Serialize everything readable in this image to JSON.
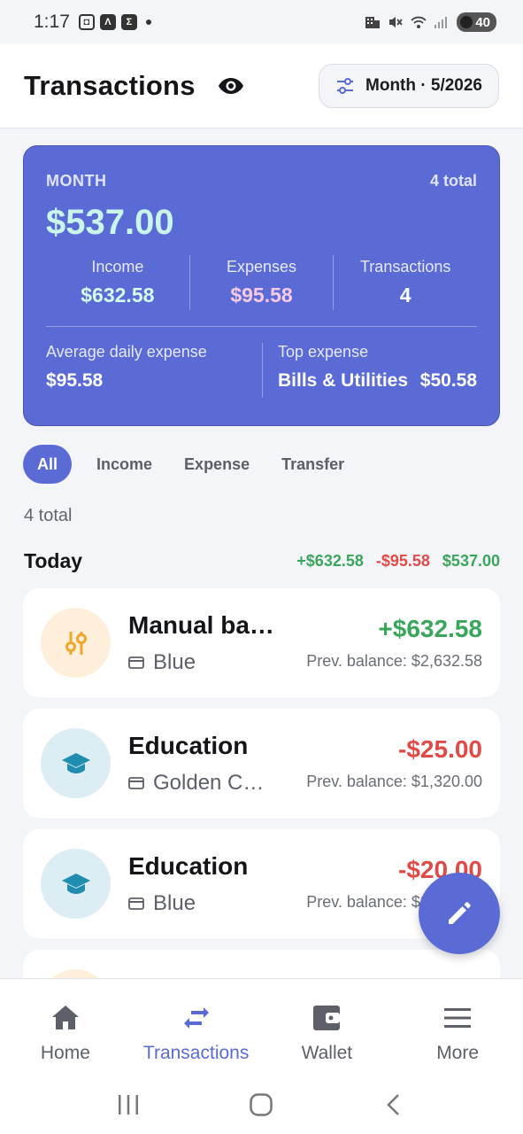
{
  "status_bar": {
    "time": "1:17",
    "battery": "40",
    "icons": [
      "screenshot-icon",
      "app-icon",
      "sigma-icon",
      "dot-icon",
      "hotel-icon",
      "mute-icon",
      "wifi-icon",
      "signal-icon",
      "battery-icon"
    ]
  },
  "header": {
    "title": "Transactions",
    "period_button": "Month · 5/2026"
  },
  "summary": {
    "period": "MONTH",
    "count_label": "4 total",
    "net": "$537.00",
    "income_label": "Income",
    "income_value": "$632.58",
    "expenses_label": "Expenses",
    "expenses_value": "$95.58",
    "transactions_label": "Transactions",
    "transactions_value": "4",
    "avg_label": "Average daily expense",
    "avg_value": "$95.58",
    "top_label": "Top expense",
    "top_category": "Bills & Utilities",
    "top_amount": "$50.58"
  },
  "filters": [
    "All",
    "Income",
    "Expense",
    "Transfer"
  ],
  "list_count": "4 total",
  "day_group": {
    "label": "Today",
    "income": "+$632.58",
    "expense": "-$95.58",
    "net": "$537.00"
  },
  "transactions": [
    {
      "title": "Manual balance adjustment",
      "account": "Blue",
      "amount": "+$632.58",
      "prev": "Prev. balance: $2,632.58",
      "icon": "adjust-icon",
      "type": "income"
    },
    {
      "title": "Education",
      "account": "Golden Card",
      "amount": "-$25.00",
      "prev": "Prev. balance: $1,320.00",
      "icon": "graduation-cap-icon",
      "type": "expense"
    },
    {
      "title": "Education",
      "account": "Blue",
      "amount": "-$20.00",
      "prev": "Prev. balance: $2,632.58",
      "icon": "graduation-cap-icon",
      "type": "expense"
    }
  ],
  "bottom_nav": [
    {
      "label": "Home",
      "icon": "home-icon"
    },
    {
      "label": "Transactions",
      "icon": "swap-icon"
    },
    {
      "label": "Wallet",
      "icon": "wallet-icon"
    },
    {
      "label": "More",
      "icon": "menu-icon"
    }
  ],
  "colors": {
    "accent": "#5b6bd6",
    "income": "#3aa65b",
    "expense": "#e04b47"
  }
}
